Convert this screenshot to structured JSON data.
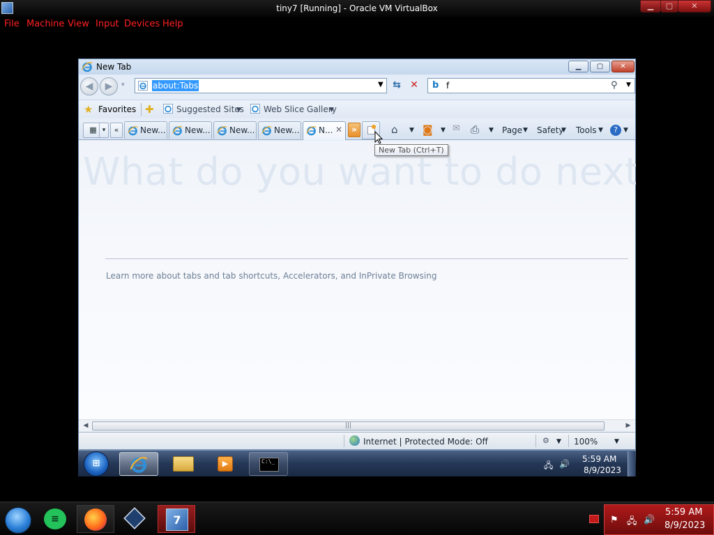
{
  "host": {
    "title": "tiny7 [Running] - Oracle VM VirtualBox",
    "menu": [
      "File",
      "Machine",
      "View",
      "Input",
      "Devices",
      "Help"
    ],
    "window_buttons": {
      "minimize": "▁",
      "maximize": "▢",
      "close": "✕"
    }
  },
  "ie": {
    "window_title": "New Tab",
    "address": "about:Tabs",
    "search_value": "f",
    "favorites_label": "Favorites",
    "favorites_items": [
      "Suggested Sites",
      "Web Slice Gallery"
    ],
    "tabs": [
      {
        "label": "New..."
      },
      {
        "label": "New..."
      },
      {
        "label": "New..."
      },
      {
        "label": "New..."
      },
      {
        "label": "N...",
        "active": true
      }
    ],
    "tab_overflow": "»",
    "tab_scroll_left": "«",
    "quicktabs_drop": "▾",
    "commands": [
      "Page",
      "Safety",
      "Tools"
    ],
    "tooltip": "New Tab (Ctrl+T)",
    "headline": "What do you want to do next?",
    "learn_more": "Learn more about tabs and tab shortcuts, Accelerators, and InPrivate Browsing",
    "status_zone": "Internet | Protected Mode: Off",
    "zoom": "100%"
  },
  "guest_taskbar": {
    "time": "5:59 AM",
    "date": "8/9/2023"
  },
  "host_taskbar": {
    "time": "5:59 AM",
    "date": "8/9/2023"
  },
  "colors": {
    "host_menu_text": "#ff2020",
    "host_tray_bg": "#b01a1a",
    "ie_chrome": "#dfe8f4",
    "address_selection": "#3399ff"
  },
  "icons": {
    "ie": "ie-icon",
    "search_provider": "bing-icon",
    "home": "home-icon",
    "feeds": "rss-icon",
    "mail": "mail-icon",
    "print": "print-icon",
    "help": "help-icon"
  }
}
